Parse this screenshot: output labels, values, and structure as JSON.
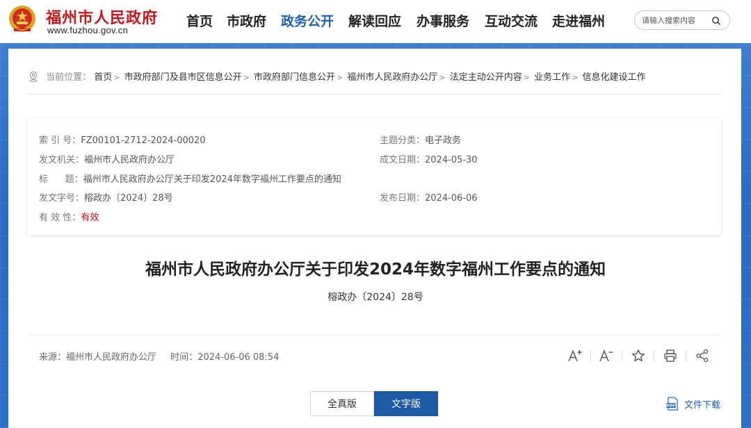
{
  "header": {
    "site_title": "福州市人民政府",
    "site_url": "www.fuzhou.gov.cn",
    "nav": [
      "首页",
      "市政府",
      "政务公开",
      "解读回应",
      "办事服务",
      "互动交流",
      "走进福州"
    ],
    "active_nav": "政务公开",
    "search_placeholder": "请输入搜索内容"
  },
  "breadcrumb": {
    "prefix": "当前位置：",
    "items": [
      "首页",
      "市政府部门及县市区信息公开",
      "市政府部门信息公开",
      "福州市人民政府办公厅",
      "法定主动公开内容",
      "业务工作",
      "信息化建设工作"
    ]
  },
  "meta": {
    "index_label": "索 引 号：",
    "index_value": "FZ00101-2712-2024-00020",
    "topic_label": "主题分类：",
    "topic_value": "电子政务",
    "issuer_label": "发文机关：",
    "issuer_value": "福州市人民政府办公厅",
    "date_written_label": "成文日期：",
    "date_written_value": "2024-05-30",
    "title_label": "标      题：",
    "title_value": "福州市人民政府办公厅关于印发2024年数字福州工作要点的通知",
    "doc_no_label": "发文字号：",
    "doc_no_value": "榕政办〔2024〕28号",
    "publish_label": "发布日期：",
    "publish_value": "2024-06-06",
    "validity_label": "有 效 性：",
    "validity_value": "有效"
  },
  "document": {
    "title": "福州市人民政府办公厅关于印发2024年数字福州工作要点的通知",
    "number": "榕政办〔2024〕28号",
    "source_label": "来源：",
    "source_value": "福州市人民政府办公厅",
    "time_label": "时间：",
    "time_value": "2024-06-06 08:54"
  },
  "tools": [
    "font-increase-icon",
    "font-decrease-icon",
    "star-icon",
    "print-icon",
    "share-icon"
  ],
  "version": {
    "full_label": "全真版",
    "text_label": "文字版",
    "active": "文字版"
  },
  "download": {
    "label": "文件下载",
    "icon_text": "PDF"
  },
  "colors": {
    "brand_red": "#c8161d",
    "brand_blue": "#1a5fb4",
    "button_blue": "#1c5aa6",
    "validity_red": "#d0021b"
  }
}
